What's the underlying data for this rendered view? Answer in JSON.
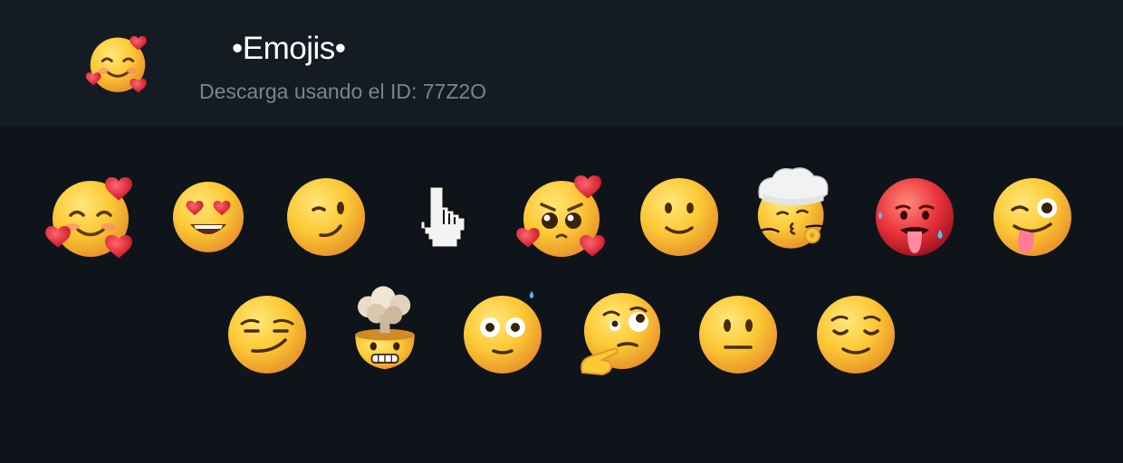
{
  "pack": {
    "title": "•Emojis•",
    "subtitle": "Descarga usando el ID: 77Z2O",
    "icon": "smiling-face-with-hearts-icon"
  },
  "stickers": [
    {
      "name": "smiling-face-with-hearts"
    },
    {
      "name": "heart-eyes"
    },
    {
      "name": "winking-face"
    },
    {
      "name": "pointing-hand-cursor"
    },
    {
      "name": "pleading-face-with-hearts"
    },
    {
      "name": "slightly-smiling-face"
    },
    {
      "name": "chef-kissing-face"
    },
    {
      "name": "hot-face"
    },
    {
      "name": "winking-face-with-tongue"
    },
    {
      "name": "smirking-face"
    },
    {
      "name": "exploding-head"
    },
    {
      "name": "flushed-face"
    },
    {
      "name": "thinking-face"
    },
    {
      "name": "neutral-face"
    },
    {
      "name": "relieved-face"
    }
  ],
  "colors": {
    "background": "#0f141b",
    "header": "#151b23",
    "face": "#fbc531",
    "heart": "#e52d3a"
  }
}
